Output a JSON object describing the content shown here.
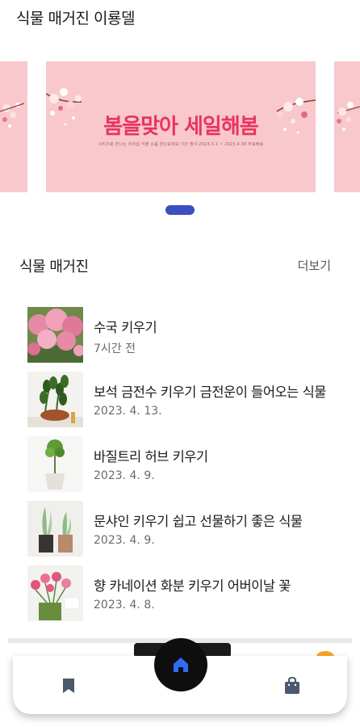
{
  "header": {
    "title": "식물 매거진 이룡델"
  },
  "banner": {
    "title": "봄을맞아 세일해봄",
    "subtitle": "시리즈로 만나는 우리집 식물 소품 만나보세요    기간 행사    2023.3.1 ~ 2023.4.30    무료배송"
  },
  "section": {
    "title": "식물 매거진",
    "more_label": "더보기"
  },
  "articles": [
    {
      "title": "수국 키우기",
      "date": "7시간 전"
    },
    {
      "title": "보석 금전수 키우기 금전운이 들어오는 식물",
      "date": "2023. 4. 13."
    },
    {
      "title": "바질트리 허브 키우기",
      "date": "2023. 4. 9."
    },
    {
      "title": "문샤인 키우기 쉽고 선물하기 좋은 식물",
      "date": "2023. 4. 9."
    },
    {
      "title": "향 카네이션 화분 키우기 어버이날 꽃",
      "date": "2023. 4. 8."
    }
  ],
  "tabbar": {
    "items": [
      {
        "icon": "bookmark-icon"
      },
      {
        "icon": "home-icon"
      },
      {
        "icon": "shopping-bag-icon"
      }
    ],
    "accent": "#2f6bf0"
  },
  "colors": {
    "banner_bg": "#f8c8cc",
    "banner_text": "#e8345d",
    "indicator": "#3c4fbf"
  }
}
